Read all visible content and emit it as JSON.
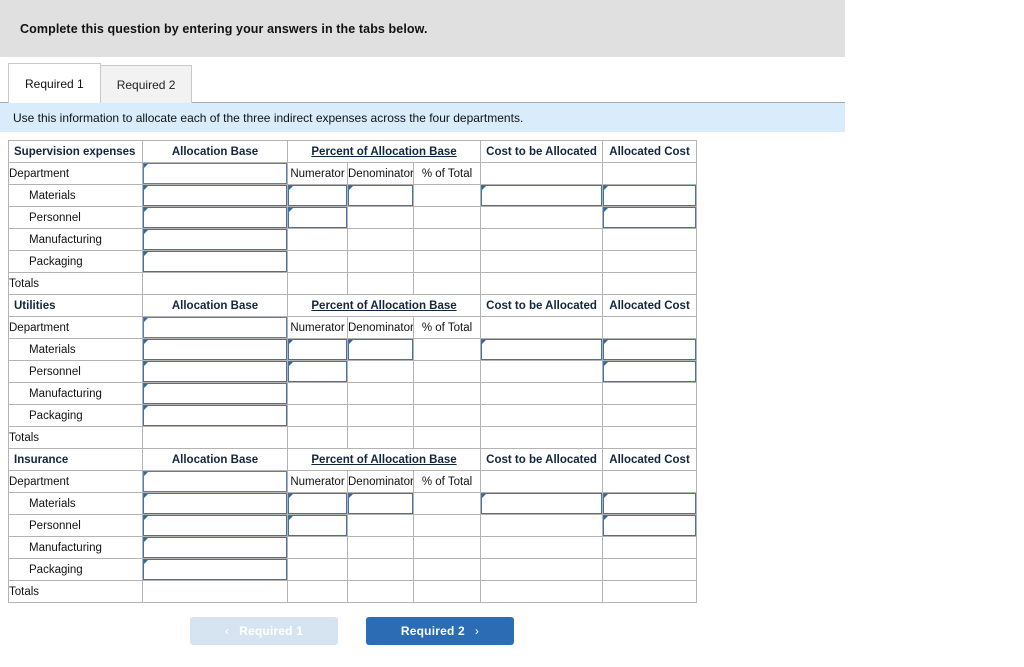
{
  "banner": {
    "text": "Complete this question by entering your answers in the tabs below."
  },
  "tabs": [
    {
      "label": "Required 1",
      "active": true
    },
    {
      "label": "Required 2",
      "active": false
    }
  ],
  "info_bar": {
    "text": "Use this information to allocate each of the three indirect expenses across the four departments."
  },
  "columns": {
    "allocation_base": "Allocation Base",
    "percent_of_allocation_base": "Percent of Allocation Base",
    "cost_to_be_allocated": "Cost to be Allocated",
    "allocated_cost": "Allocated Cost",
    "numerator": "Numerator",
    "denominator": "Denominator",
    "percent_of_total": "% of Total"
  },
  "row_labels": {
    "department": "Department",
    "materials": "Materials",
    "personnel": "Personnel",
    "manufacturing": "Manufacturing",
    "packaging": "Packaging",
    "totals": "Totals"
  },
  "sections": [
    {
      "title": "Supervision expenses"
    },
    {
      "title": "Utilities"
    },
    {
      "title": "Insurance"
    }
  ],
  "nav": {
    "prev_label": "Required 1",
    "next_label": "Required 2",
    "prev_chevron": "‹",
    "next_chevron": "›"
  },
  "colors": {
    "header_blue": "#7cadde",
    "info_blue": "#d9ecfb",
    "answer_yellow": "#ffff99",
    "banner_gray": "#e0e0e0",
    "primary_button": "#2b6cb4",
    "disabled_button": "#d6e4f2",
    "input_border": "#4f81bd"
  }
}
